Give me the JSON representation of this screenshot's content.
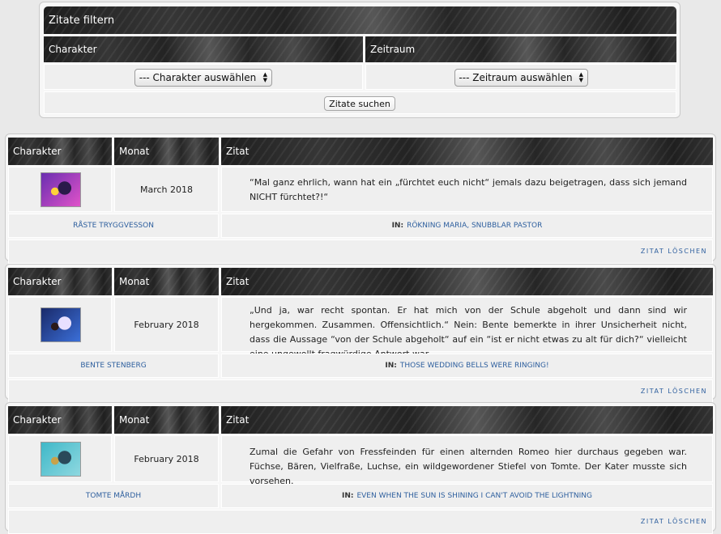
{
  "filter": {
    "title": "Zitate filtern",
    "col_character": "Charakter",
    "col_period": "Zeitraum",
    "character_select": "--- Charakter auswählen",
    "period_select": "--- Zeitraum auswählen",
    "search_button": "Zitate suchen"
  },
  "table_headers": {
    "character": "Charakter",
    "month": "Monat",
    "quote": "Zitat"
  },
  "in_label": "IN:",
  "delete_label": "Zitat löschen",
  "quotes": [
    {
      "month": "March 2018",
      "quote": "“Mal ganz ehrlich, wann hat ein „fürchtet euch nicht“ jemals dazu beigetragen, dass sich jemand NICHT fürchtet?!“",
      "character": "Råste Tryggvesson",
      "thread": "Rökning Maria, Snubblar Pastor",
      "avatar_colors": [
        "#6a2fb0",
        "#e052c9",
        "#ffd23b",
        "#2a1a4a"
      ]
    },
    {
      "month": "February 2018",
      "quote": "„Und ja, war recht spontan. Er hat mich von der Schule abgeholt und dann sind wir hergekommen. Zusammen. Offensichtlich.“ Nein: Bente bemerkte in ihrer Unsicherheit nicht, dass die Aussage “von der Schule abgeholt“ auf ein “ist er nicht etwas zu alt für dich?“ vielleicht eine ungewollt fragwürdige Antwort war.",
      "character": "Bente Stenberg",
      "thread": "Those wedding bells were ringing!",
      "avatar_colors": [
        "#1a2a6a",
        "#3b6fd8",
        "#2b1a1a",
        "#e8e0ff"
      ]
    },
    {
      "month": "February 2018",
      "quote": "Zumal die Gefahr von Fressfeinden für einen alternden Romeo hier durchaus gegeben war. Füchse, Bären, Vielfraße, Luchse, ein wildgewordener Stiefel von Tomte. Der Kater musste sich vorsehen.",
      "character": "Tomte Mårdh",
      "thread": "Even when the sun is shining I can't avoid the lightning",
      "avatar_colors": [
        "#3fb8c8",
        "#8fd8e0",
        "#c8a24a",
        "#2a4a5a"
      ]
    }
  ]
}
